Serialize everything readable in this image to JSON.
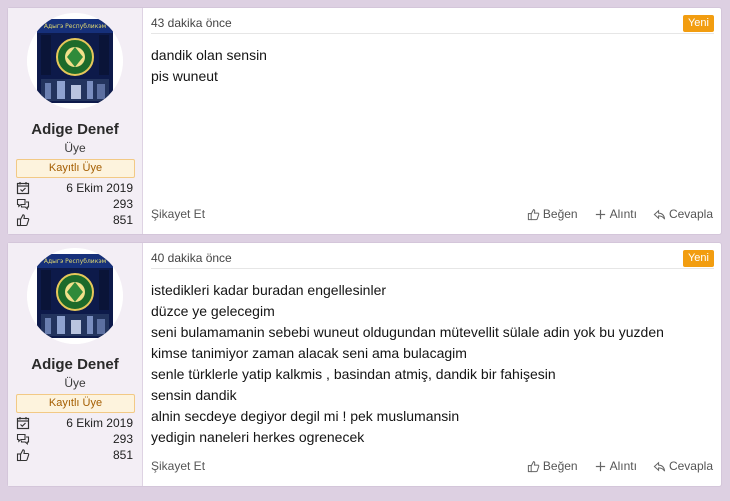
{
  "posts": [
    {
      "author": {
        "name": "Adige Denef",
        "title": "Üye",
        "banner": "Kayıtlı Üye",
        "joined": "6 Ekim 2019",
        "messages": "293",
        "reactions": "851",
        "avatar_text": "Адыгэ Республикэм"
      },
      "time": "43 dakika önce",
      "badge": "Yeni",
      "lines": [
        "dandik olan sensin",
        "pis wuneut"
      ],
      "actions": {
        "report": "Şikayet Et",
        "like": "Beğen",
        "quote": "Alıntı",
        "reply": "Cevapla"
      }
    },
    {
      "author": {
        "name": "Adige Denef",
        "title": "Üye",
        "banner": "Kayıtlı Üye",
        "joined": "6 Ekim 2019",
        "messages": "293",
        "reactions": "851",
        "avatar_text": "Адыгэ Республикэм"
      },
      "time": "40 dakika önce",
      "badge": "Yeni",
      "lines": [
        "istedikleri kadar buradan engellesinler",
        "düzce ye gelecegim",
        "seni bulamamanin sebebi wuneut oldugundan mütevellit sülale adin yok bu yuzden",
        "kimse tanimiyor zaman alacak seni ama bulacagim",
        "senle türklerle yatip kalkmis , basindan atmiş, dandik bir fahişesin",
        "sensin dandik",
        "alnin secdeye degiyor degil mi ! pek muslumansin",
        "yedigin naneleri herkes ogrenecek"
      ],
      "actions": {
        "report": "Şikayet Et",
        "like": "Beğen",
        "quote": "Alıntı",
        "reply": "Cevapla"
      }
    }
  ],
  "colors": {
    "page_bg": "#ddd0e2",
    "user_cell_bg": "#f3eef5",
    "badge_bg": "#f29d10",
    "banner_bg": "#fdf3dd",
    "banner_text": "#a45d00"
  },
  "icons": {
    "joined": "calendar-check-icon",
    "messages": "comments-icon",
    "reactions": "thumbs-up-icon",
    "like": "thumbs-up-icon",
    "quote": "plus-icon",
    "reply": "reply-icon"
  }
}
